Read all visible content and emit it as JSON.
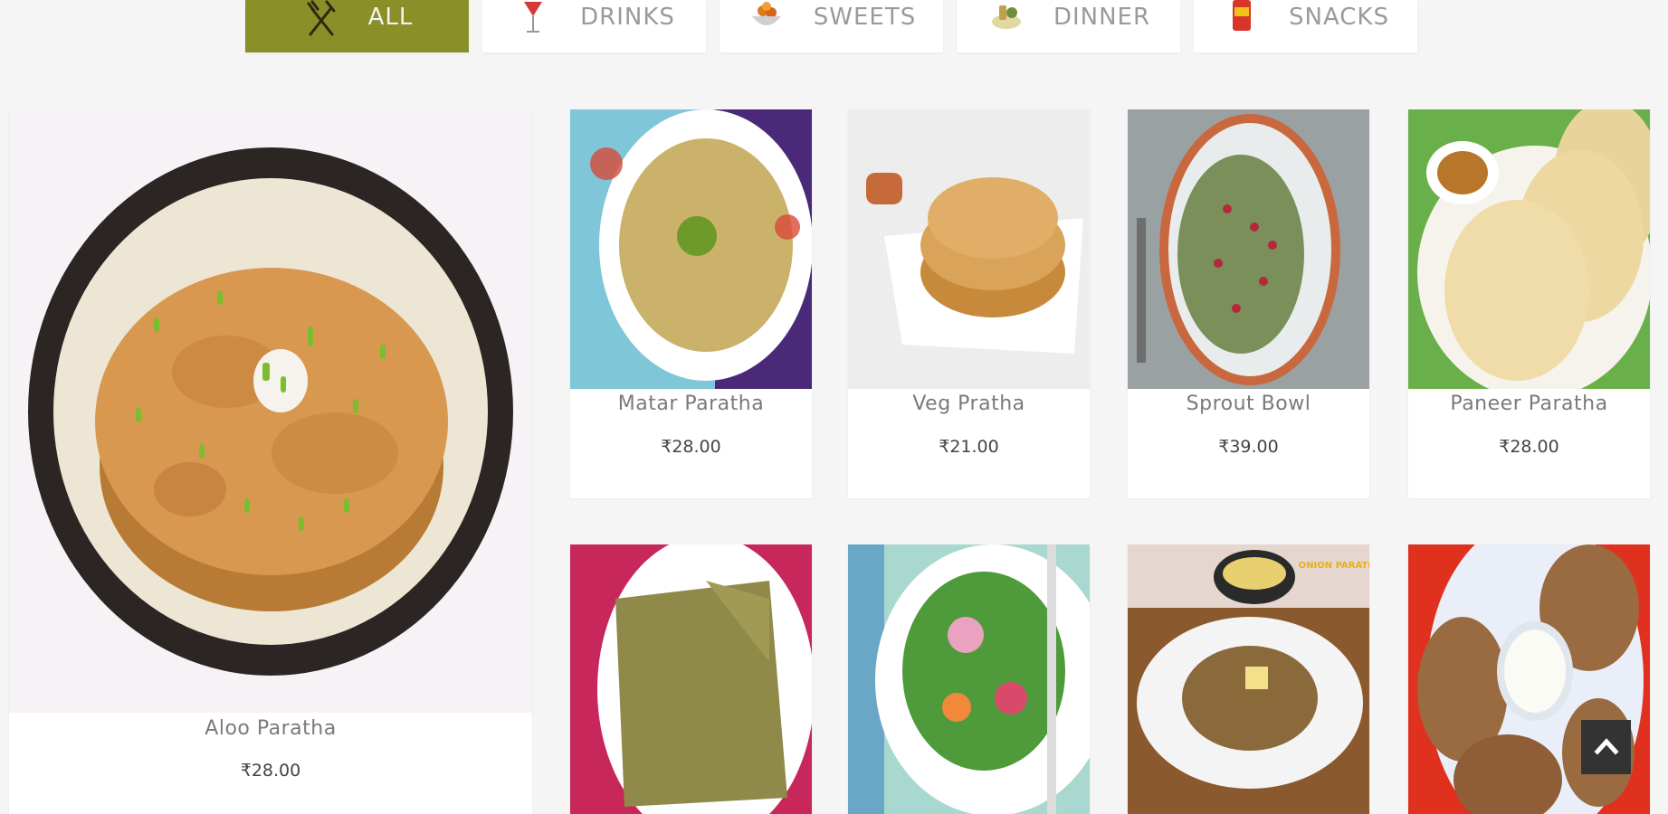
{
  "tabs": [
    {
      "label": "All",
      "icon": "fork-knife-icon",
      "active": true
    },
    {
      "label": "Drinks",
      "icon": "cocktail-glass-icon",
      "active": false
    },
    {
      "label": "Sweets",
      "icon": "sweets-bowl-icon",
      "active": false
    },
    {
      "label": "Dinner",
      "icon": "dinner-plate-icon",
      "active": false
    },
    {
      "label": "Snacks",
      "icon": "snack-packet-icon",
      "active": false
    }
  ],
  "featured": {
    "name": "Aloo Paratha",
    "price": "₹28.00",
    "icon": "aloo-paratha-photo"
  },
  "products": [
    {
      "name": "Matar Paratha",
      "price": "₹28.00",
      "icon": "matar-paratha-photo"
    },
    {
      "name": "Veg Pratha",
      "price": "₹21.00",
      "icon": "veg-pratha-photo"
    },
    {
      "name": "Sprout Bowl",
      "price": "₹39.00",
      "icon": "sprout-bowl-photo"
    },
    {
      "name": "Paneer Paratha",
      "price": "₹28.00",
      "icon": "paneer-paratha-photo"
    }
  ],
  "second_row": [
    {
      "icon": "methi-paratha-photo"
    },
    {
      "icon": "salad-bowl-photo",
      "colors": [
        "#a8d8d0",
        "#d94a6a"
      ]
    },
    {
      "icon": "onion-paratha-photo",
      "caption": "ONION PARATHA"
    },
    {
      "icon": "paratha-with-raita-photo"
    }
  ],
  "colors": {
    "accent": "#8a8f28",
    "background": "#f5f5f5"
  },
  "scroll_top": {
    "icon": "chevron-up-icon"
  }
}
